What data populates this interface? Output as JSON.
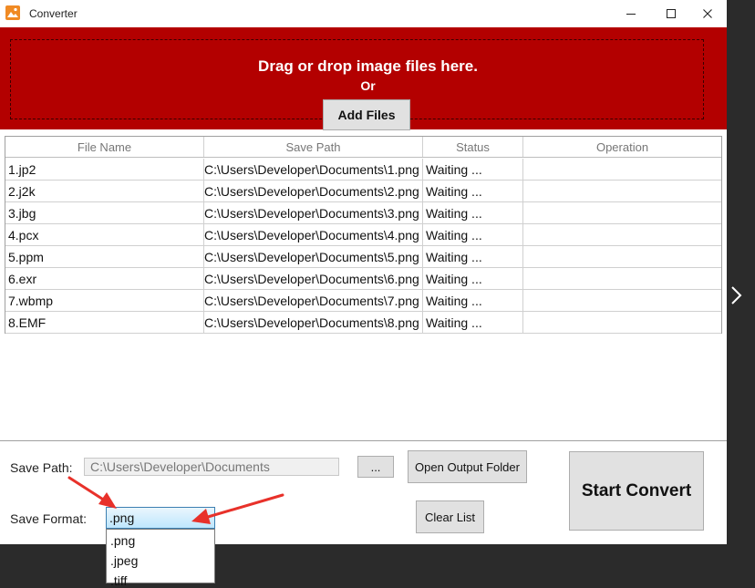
{
  "window": {
    "title": "Converter"
  },
  "dropzone": {
    "title": "Drag or drop image files here.",
    "or": "Or",
    "add_files_label": "Add Files"
  },
  "table": {
    "headers": [
      "File Name",
      "Save Path",
      "Status",
      "Operation"
    ],
    "rows": [
      {
        "file": "1.jp2",
        "path": "C:\\Users\\Developer\\Documents\\1.png",
        "status": "Waiting ..."
      },
      {
        "file": "2.j2k",
        "path": "C:\\Users\\Developer\\Documents\\2.png",
        "status": "Waiting ..."
      },
      {
        "file": "3.jbg",
        "path": "C:\\Users\\Developer\\Documents\\3.png",
        "status": "Waiting ..."
      },
      {
        "file": "4.pcx",
        "path": "C:\\Users\\Developer\\Documents\\4.png",
        "status": "Waiting ..."
      },
      {
        "file": "5.ppm",
        "path": "C:\\Users\\Developer\\Documents\\5.png",
        "status": "Waiting ..."
      },
      {
        "file": "6.exr",
        "path": "C:\\Users\\Developer\\Documents\\6.png",
        "status": "Waiting ..."
      },
      {
        "file": "7.wbmp",
        "path": "C:\\Users\\Developer\\Documents\\7.png",
        "status": "Waiting ..."
      },
      {
        "file": "8.EMF",
        "path": "C:\\Users\\Developer\\Documents\\8.png",
        "status": "Waiting ..."
      }
    ]
  },
  "bottom": {
    "save_path_label": "Save Path:",
    "save_path_value": "C:\\Users\\Developer\\Documents",
    "browse_label": "...",
    "open_folder_label": "Open Output Folder",
    "save_format_label": "Save Format:",
    "save_format_value": ".png",
    "format_options": [
      ".png",
      ".jpeg",
      ".tiff"
    ],
    "clear_list_label": "Clear List",
    "start_label": "Start Convert"
  },
  "icons": {
    "delete": "trash-icon",
    "open": "open-file-icon",
    "app": "image-app-icon",
    "minimize": "minimize-icon",
    "maximize": "maximize-icon",
    "close": "close-icon",
    "next": "chevron-right-icon"
  },
  "colors": {
    "dropzone_bg": "#b30000",
    "delete_icon": "#e03030",
    "annotation_arrow": "#e8312a",
    "select_highlight": "#bee6fd"
  }
}
